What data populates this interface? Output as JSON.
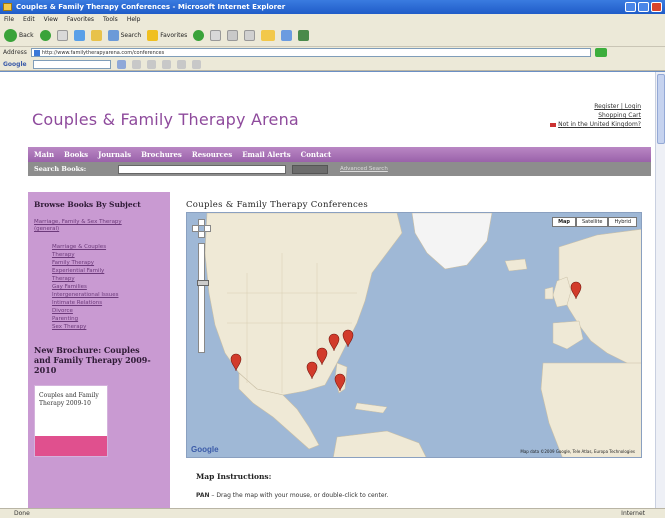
{
  "window": {
    "title": "Couples & Family Therapy Conferences - Microsoft Internet Explorer"
  },
  "menu": [
    "File",
    "Edit",
    "View",
    "Favorites",
    "Tools",
    "Help"
  ],
  "toolbar": {
    "back": "Back",
    "search": "Search",
    "favorites": "Favorites"
  },
  "address": {
    "label": "Address",
    "url": "http://www.familytherapyarena.com/conferences"
  },
  "google_bar": {
    "label": "Google"
  },
  "header": {
    "site_title": "Couples & Family Therapy Arena",
    "register_login": "Register | Login",
    "shopping_cart": "Shopping Cart",
    "region": "Not in the United Kingdom?"
  },
  "nav": [
    "Main",
    "Books",
    "Journals",
    "Brochures",
    "Resources",
    "Email Alerts",
    "Contact"
  ],
  "search": {
    "label": "Search Books:",
    "advanced": "Advanced Search"
  },
  "sidebar": {
    "heading": "Browse Books By Subject",
    "top_link": "Marriage, Family & Sex Therapy (general)",
    "subjects": [
      "Marriage & Couples",
      "Therapy",
      "Family Therapy",
      "Experiential Family",
      "Therapy",
      "Gay Families",
      "Intergenerational Issues",
      "Intimate Relations",
      "Divorce",
      "Parenting",
      "Sex Therapy"
    ],
    "brochure_heading": "New Brochure: Couples and Family Therapy 2009-2010",
    "brochure_text": "Couples and Family Therapy 2009-10"
  },
  "main": {
    "title": "Couples & Family Therapy Conferences",
    "map_types": [
      "Map",
      "Satellite",
      "Hybrid"
    ],
    "map_logo": "Google",
    "map_copyright": "Map data ©2009 Google, Tele Atlas, Europa Technologies",
    "instructions_title": "Map Instructions:",
    "pan_label": "PAN",
    "pan_text": " – Drag the map with your mouse, or double-click to center."
  },
  "status": {
    "left": "Done",
    "zone": "Internet"
  }
}
